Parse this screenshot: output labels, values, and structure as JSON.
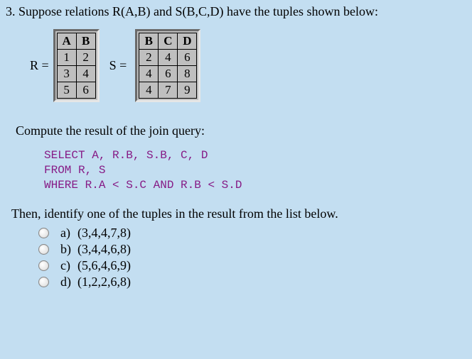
{
  "question_number": "3.",
  "question_text": "Suppose relations R(A,B) and S(B,C,D) have the tuples shown below:",
  "relation_R": {
    "label": "R =",
    "headers": [
      "A",
      "B"
    ],
    "rows": [
      [
        "1",
        "2"
      ],
      [
        "3",
        "4"
      ],
      [
        "5",
        "6"
      ]
    ]
  },
  "relation_S": {
    "label": "S =",
    "headers": [
      "B",
      "C",
      "D"
    ],
    "rows": [
      [
        "2",
        "4",
        "6"
      ],
      [
        "4",
        "6",
        "8"
      ],
      [
        "4",
        "7",
        "9"
      ]
    ]
  },
  "compute_text": "Compute the result of the join query:",
  "sql": {
    "line1": "SELECT A, R.B, S.B, C, D",
    "line2": "FROM R, S",
    "line3": "WHERE R.A < S.C AND R.B < S.D"
  },
  "identify_text": "Then, identify one of the tuples in the result from the list below.",
  "choices": [
    {
      "letter": "a)",
      "text": "(3,4,4,7,8)"
    },
    {
      "letter": "b)",
      "text": "(3,4,4,6,8)"
    },
    {
      "letter": "c)",
      "text": "(5,6,4,6,9)"
    },
    {
      "letter": "d)",
      "text": "(1,2,2,6,8)"
    }
  ]
}
